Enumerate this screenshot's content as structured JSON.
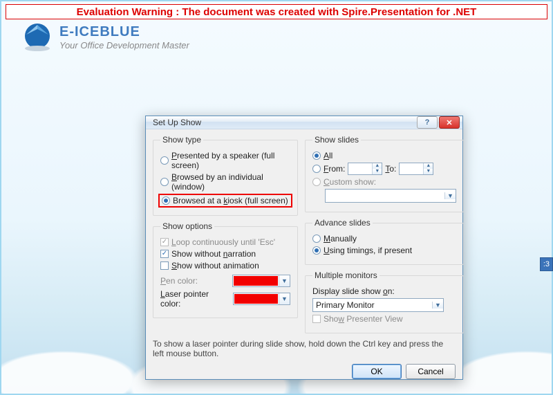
{
  "warning": "Evaluation Warning : The document was created with  Spire.Presentation for .NET",
  "brand": {
    "name": "E-ICEBLUE",
    "tagline": "Your Office Development Master"
  },
  "side_tag": ":3",
  "dialog": {
    "title": "Set Up Show",
    "help": "?",
    "close": "✕",
    "show_type": {
      "legend": "Show type",
      "opt1_pre": "P",
      "opt1_rest": "resented by a speaker (full screen)",
      "opt2_pre": "B",
      "opt2_rest": "rowsed by an individual (window)",
      "opt3_pre": "Browsed at a ",
      "opt3_key": "k",
      "opt3_rest": "iosk (full screen)"
    },
    "show_options": {
      "legend": "Show options",
      "loop_pre": "L",
      "loop_rest": "oop continuously until 'Esc'",
      "narr_pre": "Show without ",
      "narr_key": "n",
      "narr_rest": "arration",
      "anim_pre": "S",
      "anim_rest": "how without animation",
      "pen_pre": "P",
      "pen_rest": "en color:",
      "laser_pre": "L",
      "laser_rest": "aser pointer color:"
    },
    "show_slides": {
      "legend": "Show slides",
      "all_key": "A",
      "all_rest": "ll",
      "from_key": "F",
      "from_rest": "rom:",
      "to_key": "T",
      "to_rest": "o:",
      "from_val": "",
      "to_val": "",
      "custom_key": "C",
      "custom_rest": "ustom show:",
      "custom_val": ""
    },
    "advance": {
      "legend": "Advance slides",
      "manual_key": "M",
      "manual_rest": "anually",
      "timings_key": "U",
      "timings_rest": "sing timings, if present"
    },
    "monitors": {
      "legend": "Multiple monitors",
      "display_pre": "Display slide show ",
      "display_key": "o",
      "display_rest": "n:",
      "monitor_value": "Primary Monitor",
      "presenter_pre": "Sho",
      "presenter_key": "w",
      "presenter_rest": " Presenter View"
    },
    "footer": "To show a laser pointer during slide show, hold down the Ctrl key and press the left mouse button.",
    "ok": "OK",
    "cancel": "Cancel"
  }
}
